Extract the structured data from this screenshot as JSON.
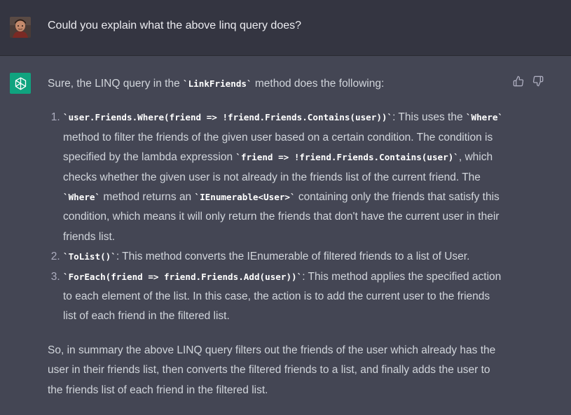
{
  "user": {
    "message": "Could you explain what the above linq query does?"
  },
  "assistant": {
    "intro": {
      "before": "Sure, the LINQ query in the ",
      "code": "`LinkFriends`",
      "after": " method does the following:"
    },
    "list": [
      {
        "code1": "`user.Friends.Where(friend => !friend.Friends.Contains(user))`",
        "t1": ": This uses the ",
        "code2": "`Where`",
        "t2": " method to filter the friends of the given user based on a certain condition. The condition is specified by the lambda expression ",
        "code3": "`friend => !friend.Friends.Contains(user)`",
        "t3": ", which checks whether the given user is not already in the friends list of the current friend. The ",
        "code4": "`Where`",
        "t4": " method returns an ",
        "code5": "`IEnumerable<User>`",
        "t5": " containing only the friends that satisfy this condition, which means it will only return the friends that don't have the current user in their friends list."
      },
      {
        "code1": "`ToList()`",
        "t1": ": This method converts the IEnumerable of filtered friends to a list of User."
      },
      {
        "code1": "`ForEach(friend => friend.Friends.Add(user))`",
        "t1": ": This method applies the specified action to each element of the list. In this case, the action is to add the current user to the friends list of each friend in the filtered list."
      }
    ],
    "summary": "So, in summary the above LINQ query filters out the friends of the user which already has the user in their friends list, then converts the filtered friends to a list, and finally adds the user to the friends list of each friend in the filtered list."
  },
  "icons": {
    "user_avatar": "user-avatar",
    "assistant_logo": "openai-logo-icon",
    "thumbs_up": "thumbs-up-icon",
    "thumbs_down": "thumbs-down-icon"
  },
  "colors": {
    "user_bg": "#343541",
    "assistant_bg": "#444654",
    "logo_bg": "#10a37f",
    "text": "#d1d5db"
  }
}
